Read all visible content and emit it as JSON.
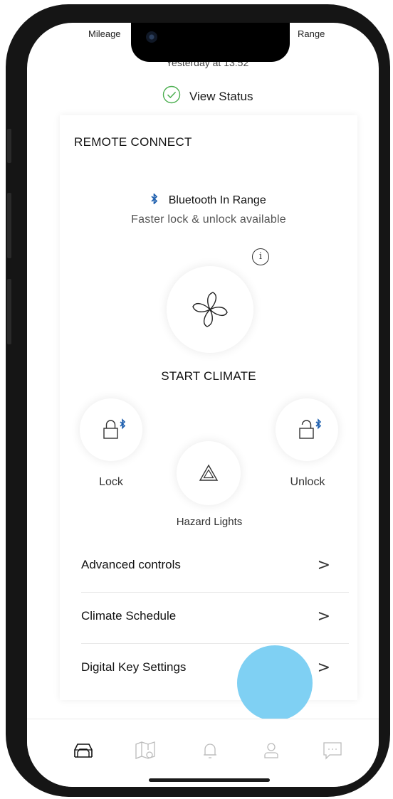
{
  "status": {
    "mileage_label": "Mileage",
    "range_label": "Range",
    "timestamp": "Yesterday at 13:52",
    "view_status": "View Status"
  },
  "remote_connect": {
    "title": "REMOTE CONNECT",
    "bluetooth_status": "Bluetooth In Range",
    "bluetooth_subtitle": "Faster lock & unlock available",
    "info_glyph": "i",
    "start_climate": "START CLIMATE",
    "lock": "Lock",
    "unlock": "Unlock",
    "hazard_lights": "Hazard Lights"
  },
  "menu": [
    {
      "label": "Advanced controls",
      "chevron": ">"
    },
    {
      "label": "Climate Schedule",
      "chevron": ">"
    },
    {
      "label": "Digital Key Settings",
      "chevron": ">"
    }
  ],
  "tabs": [
    {
      "icon": "car-icon",
      "active": true
    },
    {
      "icon": "map-icon",
      "active": false
    },
    {
      "icon": "bell-icon",
      "active": false
    },
    {
      "icon": "profile-icon",
      "active": false
    },
    {
      "icon": "chat-icon",
      "active": false
    }
  ],
  "colors": {
    "accent_blue": "#1e5fae",
    "check_green": "#4caf50",
    "touch_indicator": "#7fd0f3"
  }
}
